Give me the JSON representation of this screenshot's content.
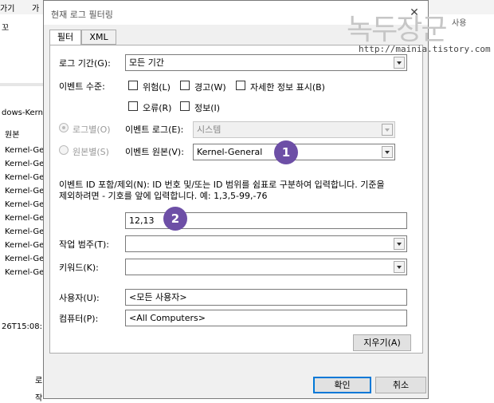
{
  "background": {
    "toolbar": [
      "가기",
      "가"
    ],
    "right_toolbar": "사용",
    "left_header": "dows-Kern",
    "left_column_header": "원본",
    "left_rows": [
      "Kernel-Ge",
      "Kernel-Ge",
      "Kernel-Ge",
      "Kernel-Ge",
      "Kernel-Ge",
      "Kernel-Ge",
      "Kernel-Ge",
      "Kernel-Ge",
      "Kernel-Ge",
      "Kernel-Ge"
    ],
    "left_timestamp": "26T15:08:",
    "left_bottom": [
      "로",
      "작"
    ],
    "left_top_small": "꼬"
  },
  "dialog": {
    "title": "현재 로그 필터링",
    "close_label": "✕",
    "tabs": [
      "필터",
      "XML"
    ],
    "log_period_label": "로그 기간(G):",
    "log_period_value": "모든 기간",
    "event_level_label": "이벤트 수준:",
    "levels": [
      "위험(L)",
      "경고(W)",
      "자세한 정보 표시(B)",
      "오류(R)",
      "정보(I)"
    ],
    "by_log_label": "로그별(O)",
    "by_source_label": "원본별(S)",
    "event_log_label": "이벤트 로그(E):",
    "event_log_value": "시스템",
    "event_source_label": "이벤트 원본(V):",
    "event_source_value": "Kernel-General",
    "id_help_line1": "이벤트 ID 포함/제외(N): ID 번호 및/또는 ID 범위를 쉼표로 구분하여 입력합니다. 기준을",
    "id_help_line2": "제외하려면 - 기호를 앞에 입력합니다. 예: 1,3,5-99,-76",
    "event_ids_value": "12,13",
    "task_category_label": "작업 범주(T):",
    "keywords_label": "키워드(K):",
    "user_label": "사용자(U):",
    "user_value": "<모든 사용자>",
    "computer_label": "컴퓨터(P):",
    "computer_value": "<All Computers>",
    "clear_button": "지우기(A)",
    "ok_button": "확인",
    "cancel_button": "취소"
  },
  "markers": [
    "1",
    "2"
  ],
  "watermark": {
    "text": "녹두장군",
    "url": "http://mainia.tistory.com"
  },
  "colors": {
    "marker": "#6d4fa6",
    "default_button_border": "#0078d7"
  }
}
